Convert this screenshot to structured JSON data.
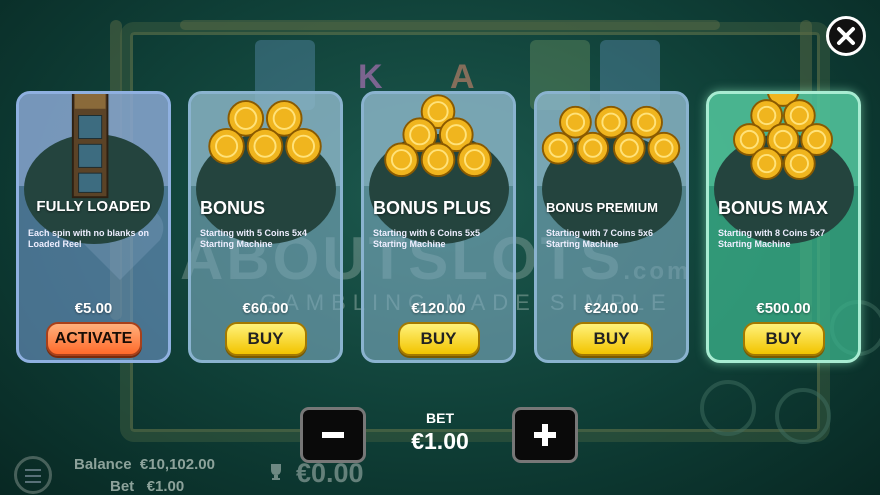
{
  "close": {
    "icon": "close-icon"
  },
  "watermark": {
    "brand": "ABOUTSLOTS",
    "suffix": ".com",
    "tagline": "GAMBLING MADE SIMPLE"
  },
  "background_letters": [
    "K",
    "A"
  ],
  "cards": [
    {
      "title": "FULLY LOADED",
      "description": "Each spin with no blanks on Loaded Reel",
      "price": "€5.00",
      "button": "ACTIVATE",
      "coins": 0
    },
    {
      "title": "BONUS",
      "description": "Starting with 5 Coins 5x4 Starting Machine",
      "price": "€60.00",
      "button": "BUY",
      "coins": 5
    },
    {
      "title": "BONUS PLUS",
      "description": "Starting with 6 Coins 5x5 Starting Machine",
      "price": "€120.00",
      "button": "BUY",
      "coins": 6
    },
    {
      "title": "BONUS PREMIUM",
      "description": "Starting with 7 Coins 5x6 Starting Machine",
      "price": "€240.00",
      "button": "BUY",
      "coins": 7
    },
    {
      "title": "BONUS MAX",
      "description": "Starting with 8 Coins 5x7 Starting Machine",
      "price": "€500.00",
      "button": "BUY",
      "coins": 8
    }
  ],
  "bet": {
    "label": "BET",
    "value": "€1.00",
    "minus_icon": "minus-icon",
    "plus_icon": "plus-icon"
  },
  "footer": {
    "balance_label": "Balance",
    "balance_value": "€10,102.00",
    "bet_label": "Bet",
    "bet_value": "€1.00",
    "win_value": "€0.00"
  },
  "colors": {
    "buy_button": "#f2c400",
    "activate_button": "#ff6a2a",
    "max_card": "#3cb48c"
  }
}
